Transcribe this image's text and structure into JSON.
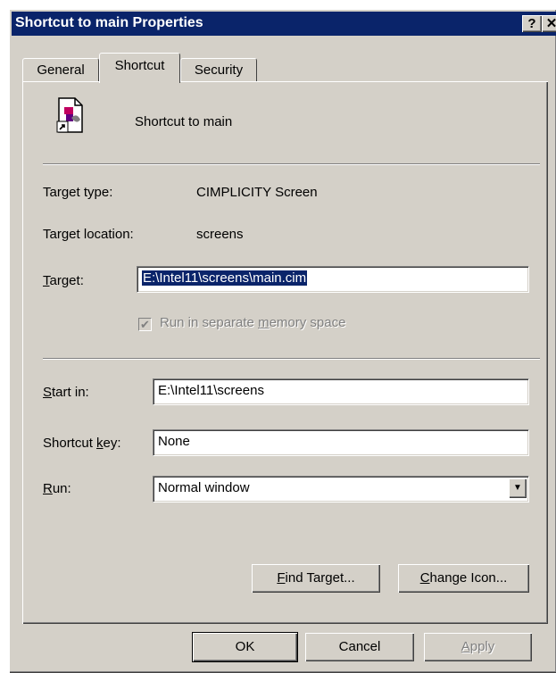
{
  "window": {
    "title": "Shortcut to main Properties",
    "help_button": "?",
    "close_button": "✕"
  },
  "tabs": [
    {
      "label": "General",
      "active": false
    },
    {
      "label": "Shortcut",
      "active": true
    },
    {
      "label": "Security",
      "active": false
    }
  ],
  "shortcut": {
    "name": "Shortcut to main",
    "icon": "shortcut-file-icon"
  },
  "info": {
    "target_type_label": "Target type:",
    "target_type_value": "CIMPLICITY Screen",
    "target_location_label": "Target location:",
    "target_location_value": "screens"
  },
  "target": {
    "label_mnemonic": "T",
    "label_rest": "arget:",
    "value": "E:\\Intel11\\screens\\main.cim"
  },
  "separate_memory": {
    "label_pre": "Run in separate ",
    "label_mnemonic": "m",
    "label_post": "emory space",
    "checked": true,
    "enabled": false
  },
  "start_in": {
    "label_mnemonic": "S",
    "label_rest": "tart in:",
    "value": "E:\\Intel11\\screens"
  },
  "shortcut_key": {
    "label_pre": "Shortcut ",
    "label_mnemonic": "k",
    "label_post": "ey:",
    "value": "None"
  },
  "run": {
    "label_mnemonic": "R",
    "label_rest": "un:",
    "value": "Normal window"
  },
  "buttons": {
    "find_target_mnemonic": "F",
    "find_target_rest": "ind Target...",
    "change_icon_mnemonic": "C",
    "change_icon_rest": "hange Icon...",
    "ok": "OK",
    "cancel": "Cancel",
    "apply_mnemonic": "A",
    "apply_rest": "pply"
  }
}
